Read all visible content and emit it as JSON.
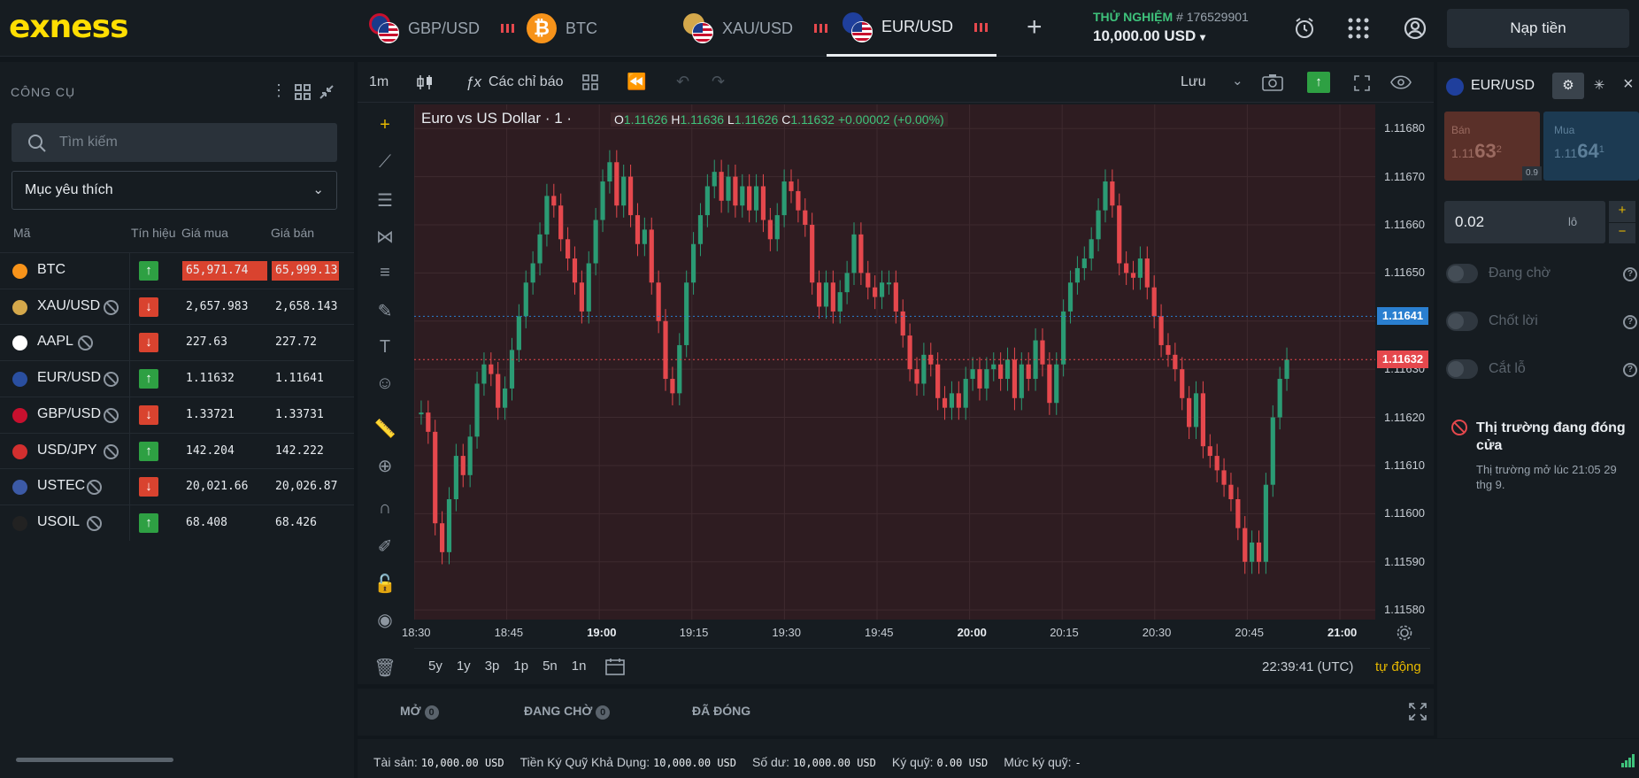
{
  "app": {
    "logo": "exness",
    "deposit_label": "Nạp tiền"
  },
  "tabs": [
    {
      "label": "GBP/USD"
    },
    {
      "label": "BTC"
    },
    {
      "label": "XAU/USD"
    },
    {
      "label": "EUR/USD",
      "active": true
    }
  ],
  "account": {
    "mode": "THỬ NGHIỆM",
    "number": "# 176529901",
    "balance": "10,000.00 USD"
  },
  "left": {
    "title": "CÔNG CỤ",
    "search_placeholder": "Tìm kiếm",
    "filter": "Mục yêu thích",
    "cols": {
      "sym": "Mã",
      "signal": "Tín hiệu",
      "bid": "Giá mua",
      "ask": "Giá bán"
    },
    "rows": [
      {
        "sym": "BTC",
        "dir": "up",
        "bid": "65,971.74",
        "ask": "65,999.13",
        "hl": true,
        "closed": false,
        "color": "#f7931a"
      },
      {
        "sym": "XAU/USD",
        "dir": "down",
        "bid": "2,657.983",
        "ask": "2,658.143",
        "closed": true,
        "color": "#d4a84b"
      },
      {
        "sym": "AAPL",
        "dir": "down",
        "bid": "227.63",
        "ask": "227.72",
        "closed": true,
        "color": "#ffffff"
      },
      {
        "sym": "EUR/USD",
        "dir": "up",
        "bid": "1.11632",
        "ask": "1.11641",
        "closed": true,
        "color": "#2a4fa0"
      },
      {
        "sym": "GBP/USD",
        "dir": "down",
        "bid": "1.33721",
        "ask": "1.33731",
        "closed": true,
        "color": "#c8102e"
      },
      {
        "sym": "USD/JPY",
        "dir": "up",
        "bid": "142.204",
        "ask": "142.222",
        "closed": true,
        "color": "#d32f2f"
      },
      {
        "sym": "USTEC",
        "dir": "down",
        "bid": "20,021.66",
        "ask": "20,026.87",
        "closed": true,
        "color": "#3c5aa6"
      },
      {
        "sym": "USOIL",
        "dir": "up",
        "bid": "68.408",
        "ask": "68.426",
        "closed": true,
        "color": "#222222"
      }
    ]
  },
  "chart_toolbar": {
    "interval": "1m",
    "indicators": "Các chỉ báo",
    "save": "Lưu"
  },
  "chart_legend": {
    "title": "Euro vs US Dollar · 1 ·",
    "o_label": "O",
    "o": "1.11626",
    "h_label": "H",
    "h": "1.11636",
    "l_label": "L",
    "l": "1.11626",
    "c_label": "C",
    "c": "1.11632",
    "chg": "+0.00002 (+0.00%)"
  },
  "chart_data": {
    "type": "candlestick",
    "title": "Euro vs US Dollar · 1 ·",
    "ylim": [
      1.11578,
      1.11685
    ],
    "yticks": [
      "1.11680",
      "1.11670",
      "1.11660",
      "1.11650",
      "1.11640",
      "1.11630",
      "1.11620",
      "1.11610",
      "1.11600",
      "1.11590",
      "1.11580"
    ],
    "xticks": [
      "18:30",
      "18:45",
      "19:00",
      "19:15",
      "19:30",
      "19:45",
      "20:00",
      "20:15",
      "20:30",
      "20:45",
      "21:00"
    ],
    "ask_price": "1.11641",
    "bid_price": "1.11632",
    "candles": [
      1.11621,
      1.11617,
      1.11598,
      1.11592,
      1.11603,
      1.11612,
      1.11608,
      1.11616,
      1.11627,
      1.11631,
      1.11629,
      1.11622,
      1.11626,
      1.11634,
      1.11641,
      1.11648,
      1.11652,
      1.11658,
      1.11666,
      1.11664,
      1.11657,
      1.11653,
      1.11648,
      1.11642,
      1.11652,
      1.11661,
      1.11669,
      1.11673,
      1.11664,
      1.1167,
      1.11662,
      1.11656,
      1.11659,
      1.11648,
      1.1164,
      1.11628,
      1.11625,
      1.11635,
      1.11648,
      1.11656,
      1.11662,
      1.11668,
      1.11671,
      1.11665,
      1.1167,
      1.11664,
      1.11668,
      1.11663,
      1.11668,
      1.11661,
      1.11657,
      1.11662,
      1.11669,
      1.11667,
      1.11663,
      1.1166,
      1.11648,
      1.11643,
      1.11648,
      1.11642,
      1.11646,
      1.1165,
      1.11658,
      1.1165,
      1.11647,
      1.11645,
      1.11648,
      1.11648,
      1.11642,
      1.11637,
      1.1163,
      1.11627,
      1.11633,
      1.11631,
      1.11624,
      1.11622,
      1.11625,
      1.11622,
      1.11628,
      1.1163,
      1.11626,
      1.1163,
      1.11631,
      1.11628,
      1.11632,
      1.11624,
      1.11631,
      1.11628,
      1.11636,
      1.11631,
      1.11623,
      1.11631,
      1.11642,
      1.11648,
      1.11651,
      1.11653,
      1.11657,
      1.11663,
      1.11669,
      1.11664,
      1.11652,
      1.1165,
      1.11649,
      1.11653,
      1.11647,
      1.11641,
      1.11635,
      1.11633,
      1.1163,
      1.11624,
      1.11618,
      1.11625,
      1.11614,
      1.11612,
      1.11609,
      1.11606,
      1.11603,
      1.11597,
      1.1159,
      1.11594,
      1.1159,
      1.11606,
      1.1162,
      1.11628,
      1.11632
    ]
  },
  "chart_bottom": {
    "ranges": [
      "5y",
      "1y",
      "3p",
      "1p",
      "5n",
      "1n"
    ],
    "clock": "22:39:41 (UTC)",
    "auto": "tự động"
  },
  "orders_tabs": [
    {
      "label": "MỞ",
      "count": "0"
    },
    {
      "label": "ĐANG CHỜ",
      "count": "0"
    },
    {
      "label": "ĐÃ ĐÓNG"
    }
  ],
  "status": [
    {
      "label": "Tài sản:",
      "value": "10,000.00 USD"
    },
    {
      "label": "Tiền Ký Quỹ Khả Dụng:",
      "value": "10,000.00 USD"
    },
    {
      "label": "Số dư:",
      "value": "10,000.00 USD"
    },
    {
      "label": "Ký quỹ:",
      "value": "0.00 USD"
    },
    {
      "label": "Mức ký quỹ:",
      "value": "-"
    }
  ],
  "right": {
    "symbol": "EUR/USD",
    "sell_label": "Bán",
    "sell_price_a": "1.11",
    "sell_price_b": "63",
    "sell_price_c": "2",
    "buy_label": "Mua",
    "buy_price_a": "1.11",
    "buy_price_b": "64",
    "buy_price_c": "1",
    "spread": "0.9",
    "volume": "0.02",
    "unit": "lô",
    "pending": "Đang chờ",
    "take_profit": "Chốt lời",
    "stop_loss": "Cắt lỗ",
    "closed_title": "Thị trường đang đóng cửa",
    "closed_sub": "Thị trường mở lúc 21:05 29 thg 9."
  }
}
